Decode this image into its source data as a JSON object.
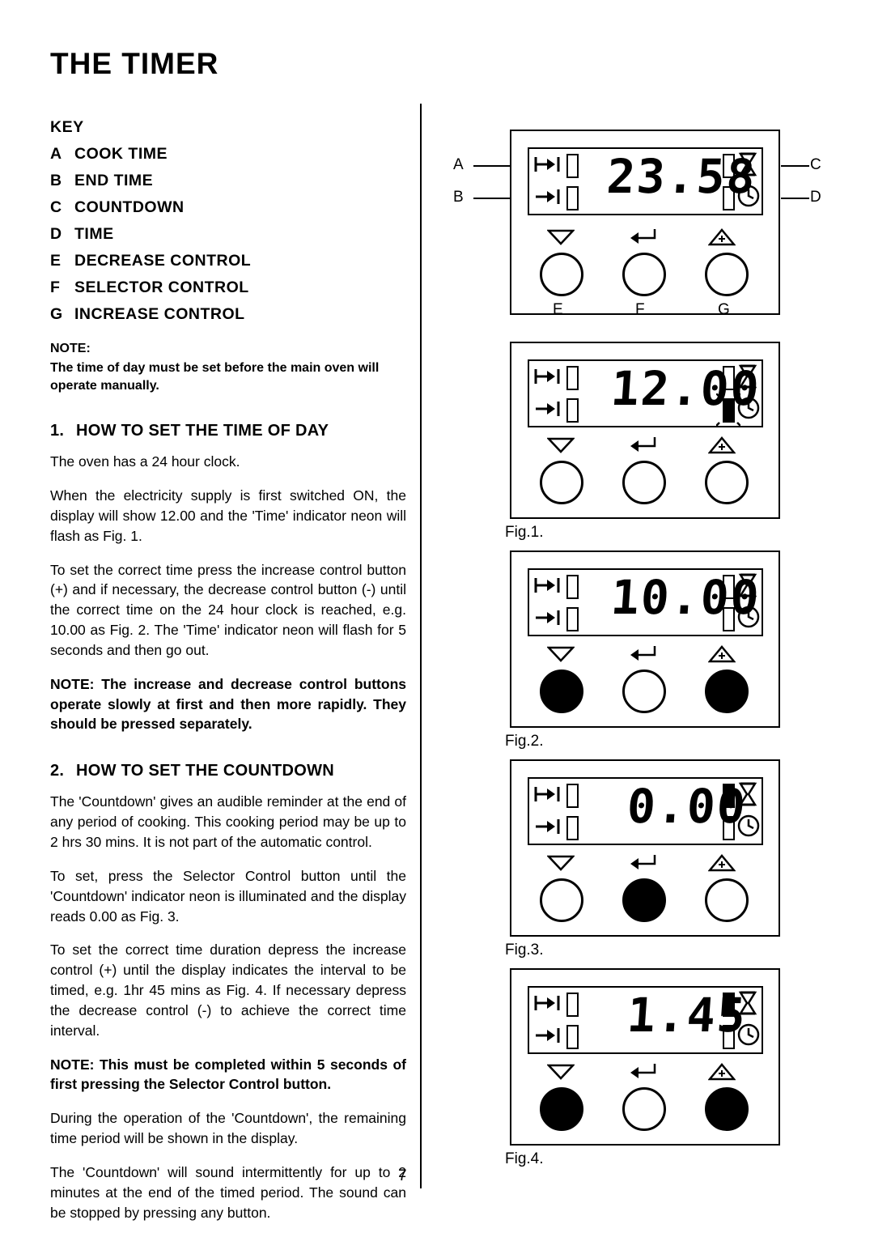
{
  "page": {
    "title": "THE TIMER",
    "number": "7"
  },
  "key": {
    "heading": "KEY",
    "items": [
      {
        "letter": "A",
        "label": "COOK TIME"
      },
      {
        "letter": "B",
        "label": "END TIME"
      },
      {
        "letter": "C",
        "label": "COUNTDOWN"
      },
      {
        "letter": "D",
        "label": "TIME"
      },
      {
        "letter": "E",
        "label": "DECREASE CONTROL"
      },
      {
        "letter": "F",
        "label": "SELECTOR CONTROL"
      },
      {
        "letter": "G",
        "label": "INCREASE CONTROL"
      }
    ]
  },
  "note_top": {
    "heading": "NOTE:",
    "body": "The time of day must be set before the main oven will operate manually."
  },
  "section1": {
    "number": "1.",
    "heading": "HOW TO SET THE TIME OF DAY",
    "p1": "The oven has a 24 hour clock.",
    "p2": "When the electricity supply is first switched ON, the display will show 12.00 and the 'Time' indicator neon will flash as Fig. 1.",
    "p3": "To set the correct time press the increase control button (+) and if necessary, the decrease control button (-) until the correct time on the 24 hour clock is reached, e.g. 10.00 as Fig. 2. The 'Time' indicator neon will flash for 5 seconds and then go out.",
    "note": "NOTE: The increase and decrease control buttons operate slowly at first and then more rapidly. They should be pressed separately."
  },
  "section2": {
    "number": "2.",
    "heading": "HOW TO SET THE COUNTDOWN",
    "p1": "The 'Countdown' gives an audible reminder at the end of any period of cooking.  This cooking period may be  up to 2 hrs 30 mins.  It is not part of the automatic control.",
    "p2": "To set, press the Selector Control button until the 'Countdown' indicator neon is illuminated and the display reads 0.00 as Fig. 3.",
    "p3": "To set the correct time duration depress the increase control (+) until the display indicates the interval to be timed, e.g. 1hr 45 mins as Fig. 4.  If necessary depress the decrease control (-) to achieve the correct time interval.",
    "note": "NOTE: This must be completed within 5 seconds of first pressing the Selector Control button.",
    "p4": "During the operation of the 'Countdown', the remaining time period will be shown in the display.",
    "p5": "The 'Countdown' will sound intermittently for up to 2 minutes at the end of the timed period.  The sound can be stopped by pressing any button."
  },
  "figures": [
    {
      "id": "fig0",
      "caption": "",
      "display": "23.58",
      "callouts": {
        "a": "A",
        "b": "B",
        "c": "C",
        "d": "D",
        "e": "E",
        "f": "F",
        "g": "G"
      },
      "buttons": [
        {
          "name": "decrease-control-button",
          "state": "off"
        },
        {
          "name": "selector-control-button",
          "state": "off"
        },
        {
          "name": "increase-control-button",
          "state": "off"
        }
      ],
      "indicators": {
        "cook": "off",
        "end": "off",
        "countdown": "off",
        "time": "off"
      }
    },
    {
      "id": "fig1",
      "caption": "Fig.1.",
      "display": "12.00",
      "buttons": [
        {
          "name": "decrease-control-button",
          "state": "off"
        },
        {
          "name": "selector-control-button",
          "state": "off"
        },
        {
          "name": "increase-control-button",
          "state": "off"
        }
      ],
      "indicators": {
        "cook": "off",
        "end": "off",
        "countdown": "off",
        "time": "flashing"
      }
    },
    {
      "id": "fig2",
      "caption": "Fig.2.",
      "display": "10.00",
      "buttons": [
        {
          "name": "decrease-control-button",
          "state": "on"
        },
        {
          "name": "selector-control-button",
          "state": "off"
        },
        {
          "name": "increase-control-button",
          "state": "on"
        }
      ],
      "indicators": {
        "cook": "off",
        "end": "off",
        "countdown": "off",
        "time": "off"
      }
    },
    {
      "id": "fig3",
      "caption": "Fig.3.",
      "display": "0.00",
      "buttons": [
        {
          "name": "decrease-control-button",
          "state": "off"
        },
        {
          "name": "selector-control-button",
          "state": "on"
        },
        {
          "name": "increase-control-button",
          "state": "off"
        }
      ],
      "indicators": {
        "cook": "off",
        "end": "off",
        "countdown": "on",
        "time": "off"
      }
    },
    {
      "id": "fig4",
      "caption": "Fig.4.",
      "display": "1.45",
      "buttons": [
        {
          "name": "decrease-control-button",
          "state": "on"
        },
        {
          "name": "selector-control-button",
          "state": "off"
        },
        {
          "name": "increase-control-button",
          "state": "on"
        }
      ],
      "indicators": {
        "cook": "off",
        "end": "off",
        "countdown": "on",
        "time": "off"
      }
    }
  ],
  "colors": {
    "ink": "#000000",
    "paper": "#ffffff"
  }
}
